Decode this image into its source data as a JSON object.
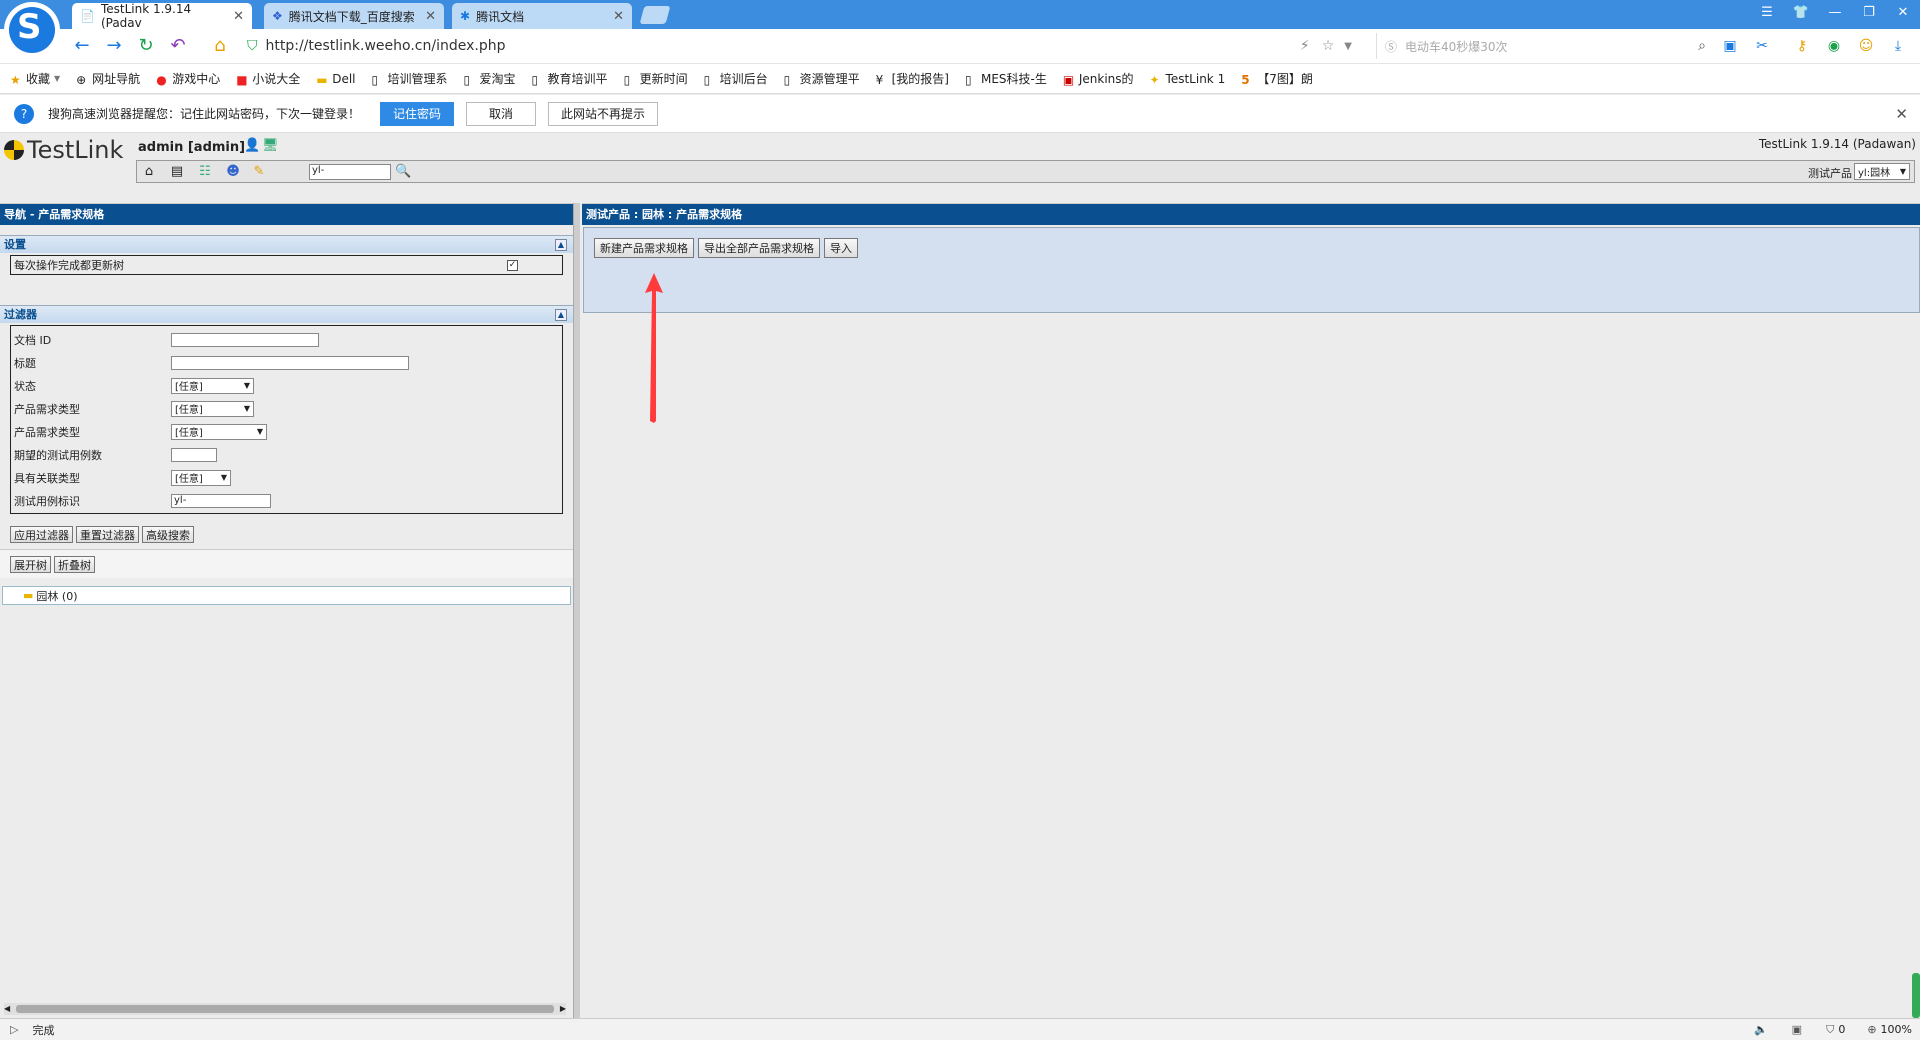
{
  "browser": {
    "tabs": [
      {
        "title": "TestLink 1.9.14 (Padav",
        "active": true
      },
      {
        "title": "腾讯文档下载_百度搜索",
        "active": false
      },
      {
        "title": "腾讯文档",
        "active": false
      }
    ],
    "url": "http://testlink.weeho.cn/index.php",
    "search_placeholder": "电动车40秒爆30次",
    "bookmarks": [
      "收藏",
      "网址导航",
      "游戏中心",
      "小说大全",
      "Dell",
      "培训管理系",
      "爱淘宝",
      "教育培训平",
      "更新时间",
      "培训后台",
      "资源管理平",
      "[我的报告]",
      "MES科技-生",
      "Jenkins的",
      "TestLink 1",
      "【7图】朗"
    ],
    "notify": {
      "text": "搜狗高速浏览器提醒您：记住此网站密码，下次一键登录！",
      "remember": "记住密码",
      "cancel": "取消",
      "never": "此网站不再提示"
    },
    "status": {
      "text": "完成",
      "count": "0",
      "zoom": "100%"
    }
  },
  "testlink": {
    "logo": "TestLink",
    "user": "admin [admin]",
    "version": "TestLink 1.9.14 (Padawan)",
    "search_value": "yl-",
    "product_label": "测试产品",
    "product_value": "yl:园林"
  },
  "left": {
    "title": "导航 - 产品需求规格",
    "settings_title": "设置",
    "update_tree_label": "每次操作完成都更新树",
    "filters_title": "过滤器",
    "filters": [
      {
        "label": "文档 ID",
        "type": "input",
        "value": ""
      },
      {
        "label": "标题",
        "type": "input",
        "value": ""
      },
      {
        "label": "状态",
        "type": "select",
        "value": "[任意]"
      },
      {
        "label": "产品需求类型",
        "type": "select",
        "value": "[任意]"
      },
      {
        "label": "产品需求类型",
        "type": "select",
        "value": "[任意]"
      },
      {
        "label": "期望的测试用例数",
        "type": "input",
        "value": ""
      },
      {
        "label": "具有关联类型",
        "type": "select",
        "value": "[任意]"
      },
      {
        "label": "测试用例标识",
        "type": "input",
        "value": "yl-"
      }
    ],
    "apply_filter": "应用过滤器",
    "reset_filter": "重置过滤器",
    "advanced_search": "高级搜索",
    "expand_tree": "展开树",
    "collapse_tree": "折叠树",
    "tree_root": "园林 (0)"
  },
  "right": {
    "title": "测试产品 : 园林 : 产品需求规格",
    "new_spec": "新建产品需求规格",
    "export_all": "导出全部产品需求规格",
    "import": "导入"
  },
  "annotation_color": "#ff3b3b"
}
